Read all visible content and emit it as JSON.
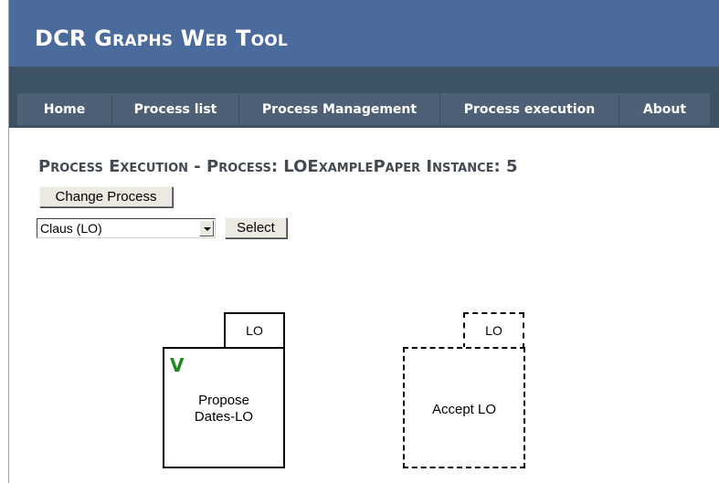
{
  "app": {
    "title": "DCR Graphs Web Tool"
  },
  "nav": {
    "home": "Home",
    "process_list": "Process list",
    "process_management": "Process Management",
    "process_execution": "Process execution",
    "about": "About"
  },
  "page": {
    "title": "Process Execution - Process: LOExamplePaper Instance: 5",
    "change_process_button": "Change Process",
    "role_select_value": "Claus (LO)",
    "select_button": "Select"
  },
  "graph": {
    "events": [
      {
        "label": "Propose Dates-LO",
        "role": "LO",
        "executed": true,
        "executed_mark": "V",
        "enabled": true
      },
      {
        "label": "Accept LO",
        "role": "LO",
        "executed": false,
        "enabled": false
      }
    ]
  },
  "colors": {
    "header": "#4a6b9b",
    "nav": "#3e5266",
    "nav_item": "#4d6075",
    "executed_mark": "#1f8a1f"
  }
}
